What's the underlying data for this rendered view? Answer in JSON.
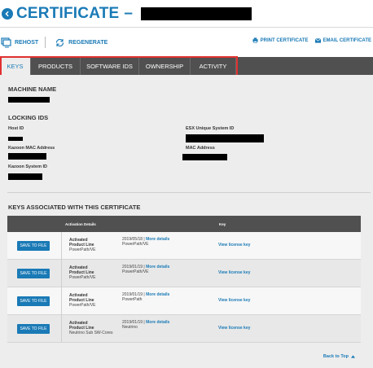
{
  "header": {
    "title": "CERTIFICATE",
    "dash": "–"
  },
  "actions": {
    "rehost": "REHOST",
    "regenerate": "REGENERATE",
    "print": "PRINT CERTIFICATE",
    "email": "EMAIL CERTIFICATE"
  },
  "tabs": [
    {
      "label": "KEYS"
    },
    {
      "label": "PRODUCTS"
    },
    {
      "label": "SOFTWARE IDS"
    },
    {
      "label": "OWNERSHIP"
    },
    {
      "label": "ACTIVITY"
    }
  ],
  "machine": {
    "heading": "MACHINE NAME"
  },
  "locking": {
    "heading": "LOCKING IDS",
    "host_id": "Host ID",
    "esx_id": "ESX Unique System ID",
    "kazoon_mac": "Kazoon MAC Address",
    "mac": "MAC Address",
    "kazoon_system": "Kazoon System ID"
  },
  "keys": {
    "heading": "KEYS ASSOCIATED WITH THIS CERTIFICATE",
    "col_activation": "Activation Details",
    "col_key": "Key",
    "save_label": "SAVE TO FILE",
    "activated_label": "Activated",
    "product_line_label": "Product Line",
    "more_details": "More details",
    "view_key": "View license key",
    "rows": [
      {
        "product_line": "PowerPath/VE",
        "date": "2019/05/18 | ",
        "product": "PowerPath/VE"
      },
      {
        "product_line": "PowerPath/VE",
        "date": "2019/01/19 | ",
        "product": "PowerPath/VE"
      },
      {
        "product_line": "PowerPath/VE",
        "date": "2019/01/19 | ",
        "product": "PowerPath"
      },
      {
        "product_line": "Neutrino Sub SW-Cores",
        "date": "2019/01/19 | ",
        "product": "Neutrino"
      }
    ]
  },
  "footer": {
    "back_to_top": "Back to Top"
  },
  "colors": {
    "accent": "#1a7ab6",
    "tab_bar": "#505050",
    "highlight": "#e03030"
  }
}
